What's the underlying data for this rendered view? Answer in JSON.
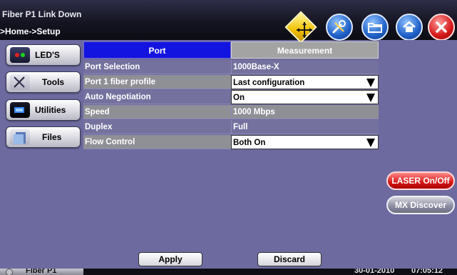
{
  "window": {
    "title": "Fiber P1 Link Down",
    "breadcrumb": ">Home->Setup"
  },
  "header_icons": [
    "pin-icon",
    "tools-icon",
    "folder-icon",
    "home-icon",
    "close-icon"
  ],
  "sidebar": {
    "items": [
      {
        "label": "LED'S",
        "icon": "leds-icon"
      },
      {
        "label": "Tools",
        "icon": "tools-icon"
      },
      {
        "label": "Utilities",
        "icon": "utilities-icon"
      },
      {
        "label": "Files",
        "icon": "files-icon"
      }
    ]
  },
  "tabs": {
    "port": "Port",
    "measurement": "Measurement"
  },
  "settings": {
    "rows": [
      {
        "name": "Port Selection",
        "value": "1000Base-X",
        "dropdown": false
      },
      {
        "name": "Port 1 fiber profile",
        "value": "Last configuration",
        "dropdown": true
      },
      {
        "name": "Auto Negotiation",
        "value": "On",
        "dropdown": true
      },
      {
        "name": "Speed",
        "value": "1000 Mbps",
        "dropdown": false
      },
      {
        "name": "Duplex",
        "value": "Full",
        "dropdown": false
      },
      {
        "name": "Flow Control",
        "value": "Both On",
        "dropdown": true
      }
    ]
  },
  "actions": {
    "apply": "Apply",
    "discard": "Discard"
  },
  "right_panel": {
    "laser": "LASER On/Off",
    "mx": "MX Discover"
  },
  "statusbar": {
    "port": "Fiber P1",
    "date": "30-01-2010",
    "time": "07:05:12"
  },
  "colors": {
    "background": "#6d6aa0",
    "tab_active": "#1414e0",
    "tab_inactive": "#a3a3a3",
    "laser_button": "#d81818"
  }
}
